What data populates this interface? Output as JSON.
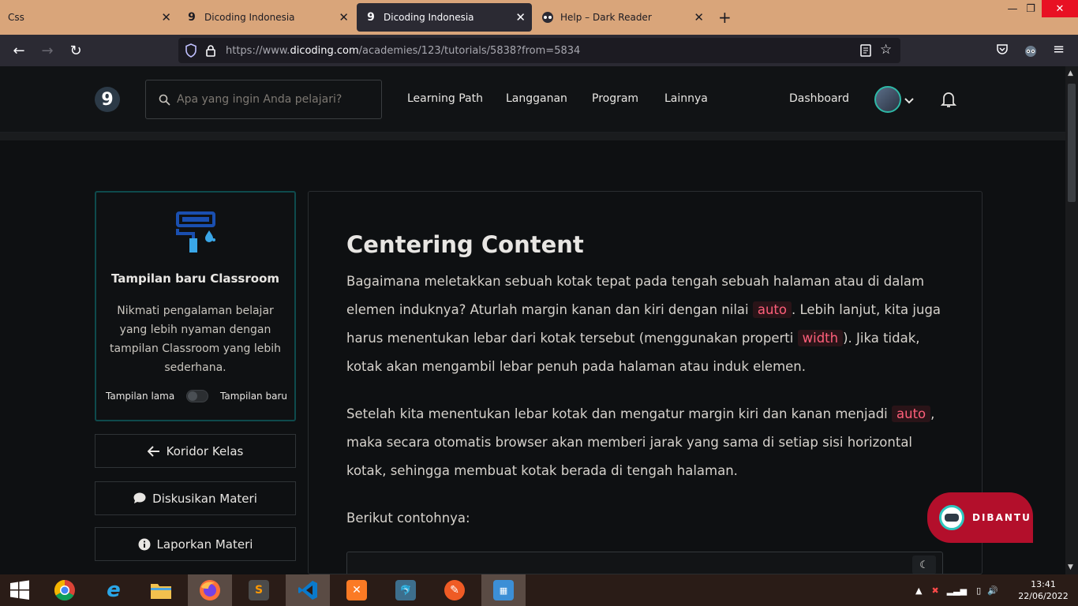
{
  "browser": {
    "tabs": [
      {
        "title": "Css",
        "favicon": "none"
      },
      {
        "title": "Dicoding Indonesia",
        "favicon": "dicoding-icon"
      },
      {
        "title": "Dicoding Indonesia",
        "favicon": "dicoding-icon",
        "active": true
      },
      {
        "title": "Help – Dark Reader",
        "favicon": "dark-reader-icon"
      }
    ],
    "new_tab_label": "+",
    "url_prefix": "https://www.",
    "url_domain": "dicoding.com",
    "url_path": "/academies/123/tutorials/5838?from=5834"
  },
  "header": {
    "logo_text": "9",
    "search_placeholder": "Apa yang ingin Anda pelajari?",
    "menu": [
      "Learning Path",
      "Langganan",
      "Program",
      "Lainnya"
    ],
    "dashboard_label": "Dashboard"
  },
  "sidebar": {
    "promo_title": "Tampilan baru Classroom",
    "promo_desc": "Nikmati pengalaman belajar yang lebih nyaman dengan tampilan Classroom yang lebih sederhana.",
    "toggle_old": "Tampilan lama",
    "toggle_new": "Tampilan baru",
    "buttons": [
      "Koridor Kelas",
      "Diskusikan Materi",
      "Laporkan Materi"
    ]
  },
  "article": {
    "title": "Centering Content",
    "p1_a": "Bagaimana meletakkan sebuah kotak tepat pada tengah sebuah halaman atau di dalam elemen induknya? Aturlah margin kanan dan kiri dengan nilai ",
    "p1_code1": "auto",
    "p1_b": ". Lebih lanjut, kita juga harus menentukan lebar dari kotak tersebut (menggunakan properti ",
    "p1_code2": "width",
    "p1_c": "). Jika tidak, kotak akan mengambil lebar penuh pada halaman atau induk elemen.",
    "p2_a": "Setelah kita menentukan lebar kotak dan mengatur margin kiri dan kanan menjadi ",
    "p2_code": "auto",
    "p2_b": ", maka secara otomatis browser akan memberi jarak yang sama di setiap sisi horizontal kotak, sehingga membuat kotak berada di tengah halaman.",
    "p3": "Berikut contohnya:"
  },
  "help_button": "DIBANTU",
  "taskbar": {
    "time": "13:41",
    "date": "22/06/2022"
  },
  "colors": {
    "accent_teal": "#2eb8a6",
    "code_pink": "#ff5f7a",
    "help_red": "#b30f2b",
    "tab_bar": "#d9a57a"
  }
}
